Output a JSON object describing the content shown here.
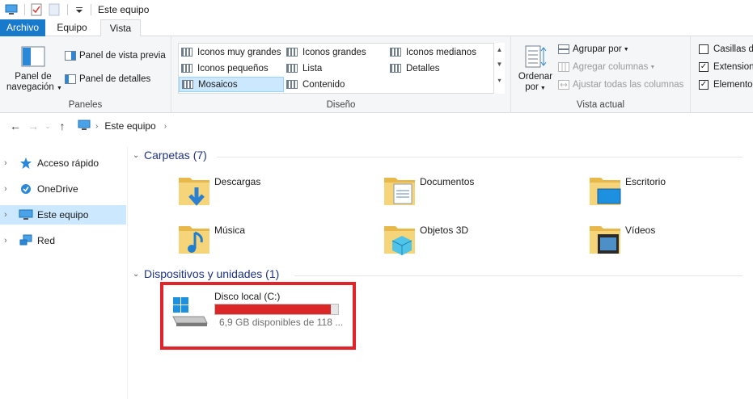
{
  "window": {
    "title": "Este equipo"
  },
  "ribbon_tabs": [
    {
      "label": "Archivo"
    },
    {
      "label": "Equipo"
    },
    {
      "label": "Vista"
    }
  ],
  "ribbon": {
    "panes": {
      "nav_pane_line1": "Panel de",
      "nav_pane_line2": "navegación",
      "preview_pane": "Panel de vista previa",
      "details_pane": "Panel de detalles",
      "group_label": "Paneles"
    },
    "layout": {
      "group_label": "Diseño",
      "options": [
        "Iconos muy grandes",
        "Iconos grandes",
        "Iconos medianos",
        "Iconos pequeños",
        "Lista",
        "Detalles",
        "Mosaicos",
        "Contenido"
      ],
      "selected": "Mosaicos"
    },
    "current_view": {
      "sort_line1": "Ordenar",
      "sort_line2": "por",
      "group_by": "Agrupar por",
      "add_columns": "Agregar columnas",
      "fit_columns": "Ajustar todas las columnas",
      "group_label": "Vista actual"
    },
    "show_hide": {
      "items": [
        {
          "label": "Casillas d",
          "checked": false
        },
        {
          "label": "Extension",
          "checked": true
        },
        {
          "label": "Elemento",
          "checked": true
        }
      ]
    }
  },
  "address": {
    "path": "Este equipo"
  },
  "nav_pane": {
    "items": [
      {
        "label": "Acceso rápido"
      },
      {
        "label": "OneDrive"
      },
      {
        "label": "Este equipo"
      },
      {
        "label": "Red"
      }
    ]
  },
  "content": {
    "folders_header": "Carpetas (7)",
    "folders": [
      {
        "name": "Descargas"
      },
      {
        "name": "Documentos"
      },
      {
        "name": "Escritorio"
      },
      {
        "name": "Música"
      },
      {
        "name": "Objetos 3D"
      },
      {
        "name": "Vídeos"
      }
    ],
    "devices_header": "Dispositivos y unidades (1)",
    "drive": {
      "name": "Disco local (C:)",
      "free_text": "6,9 GB disponibles de 118 ...",
      "used_fraction": 0.94,
      "bar_color": "#da2626"
    }
  }
}
